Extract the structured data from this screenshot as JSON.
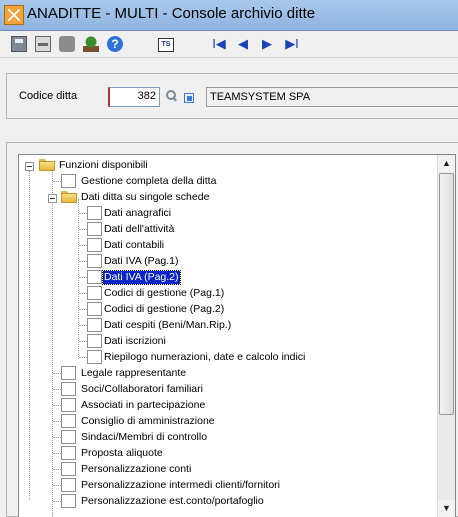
{
  "window": {
    "title": "ANADITTE  -  MULTI  -  Console archivio ditte"
  },
  "toolbar": {
    "icons": [
      "save-icon",
      "print-icon",
      "cut-icon",
      "tree-icon",
      "help-icon",
      "ts-icon",
      "first-record-icon",
      "previous-record-icon",
      "next-record-icon",
      "last-record-icon"
    ],
    "help_glyph": "?",
    "ts_label": "TS",
    "nav_glyphs": {
      "first": "I◀",
      "prev": "◀",
      "next": "▶",
      "last": "▶I"
    }
  },
  "header": {
    "code_label": "Codice ditta",
    "code_value": "382",
    "company_name": "TEAMSYSTEM SPA"
  },
  "tree": {
    "root_label": "Funzioni disponibili",
    "items": [
      {
        "label": "Gestione completa della ditta"
      },
      {
        "label": "Dati ditta su singole schede"
      },
      {
        "label": "Dati anagrafici"
      },
      {
        "label": "Dati dell'attività"
      },
      {
        "label": "Dati contabili"
      },
      {
        "label": "Dati IVA (Pag.1)"
      },
      {
        "label": "Dati IVA (Pag.2)"
      },
      {
        "label": "Codici di gestione (Pag.1)"
      },
      {
        "label": "Codici di gestione (Pag.2)"
      },
      {
        "label": "Dati cespiti (Beni/Man.Rip.)"
      },
      {
        "label": "Dati iscrizioni"
      },
      {
        "label": "Riepilogo numerazioni, date e calcolo indici"
      },
      {
        "label": "Legale rappresentante"
      },
      {
        "label": "Soci/Collaboratori familiari"
      },
      {
        "label": "Associati in partecipazione"
      },
      {
        "label": "Consiglio di amministrazione"
      },
      {
        "label": "Sindaci/Membri di controllo"
      },
      {
        "label": "Proposta aliquote"
      },
      {
        "label": "Personalizzazione conti"
      },
      {
        "label": "Personalizzazione intermedi clienti/fornitori"
      },
      {
        "label": "Personalizzazione est.conto/portafoglio"
      }
    ],
    "selected_label": "Dati IVA (Pag.2)"
  },
  "scrollbar": {
    "up_glyph": "▲",
    "down_glyph": "▼"
  },
  "colors": {
    "selection": "#0a24c6",
    "titlebar": "#a9c9ec",
    "required_field_marker": "#b4362e"
  }
}
